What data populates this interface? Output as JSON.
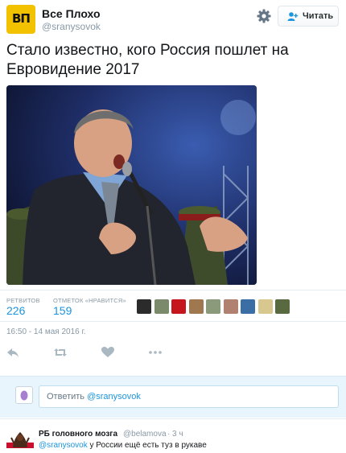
{
  "profile": {
    "avatar_text": "ВП",
    "display_name": "Все Плохо",
    "handle": "@sranysovok",
    "follow_label": "Читать"
  },
  "tweet": {
    "text": "Стало известно, кого Россия пошлет на Евровидение 2017",
    "photo_icon": "man-singing-photo",
    "timestamp": "16:50 - 14 мая 2016 г."
  },
  "stats": {
    "retweets_label": "РЕТВИТОВ",
    "retweets": "226",
    "likes_label": "ОТМЕТОК «НРАВИТСЯ»",
    "likes": "159",
    "liker_colors": [
      "#2b2b2b",
      "#7a8a6a",
      "#c4161c",
      "#a07850",
      "#8a9a7a",
      "#b08070",
      "#3a6ea5",
      "#d8c890",
      "#5a6a40"
    ]
  },
  "actions": {
    "reply_icon": "reply-icon",
    "retweet_icon": "retweet-icon",
    "like_icon": "heart-icon",
    "more_icon": "more-icon"
  },
  "reply_box": {
    "placeholder_prefix": "Ответить ",
    "placeholder_mention": "@sranysovok"
  },
  "reply_tweet": {
    "name": "РБ головного мозга",
    "handle": "@belamova",
    "separator": "·",
    "time": "3 ч",
    "mention": "@sranysovok",
    "text": " у России ещё есть туз в рукаве"
  },
  "colors": {
    "accent": "#1b95e0",
    "avatar_bg": "#f2c200",
    "reply_bg": "#e8f5fd"
  }
}
